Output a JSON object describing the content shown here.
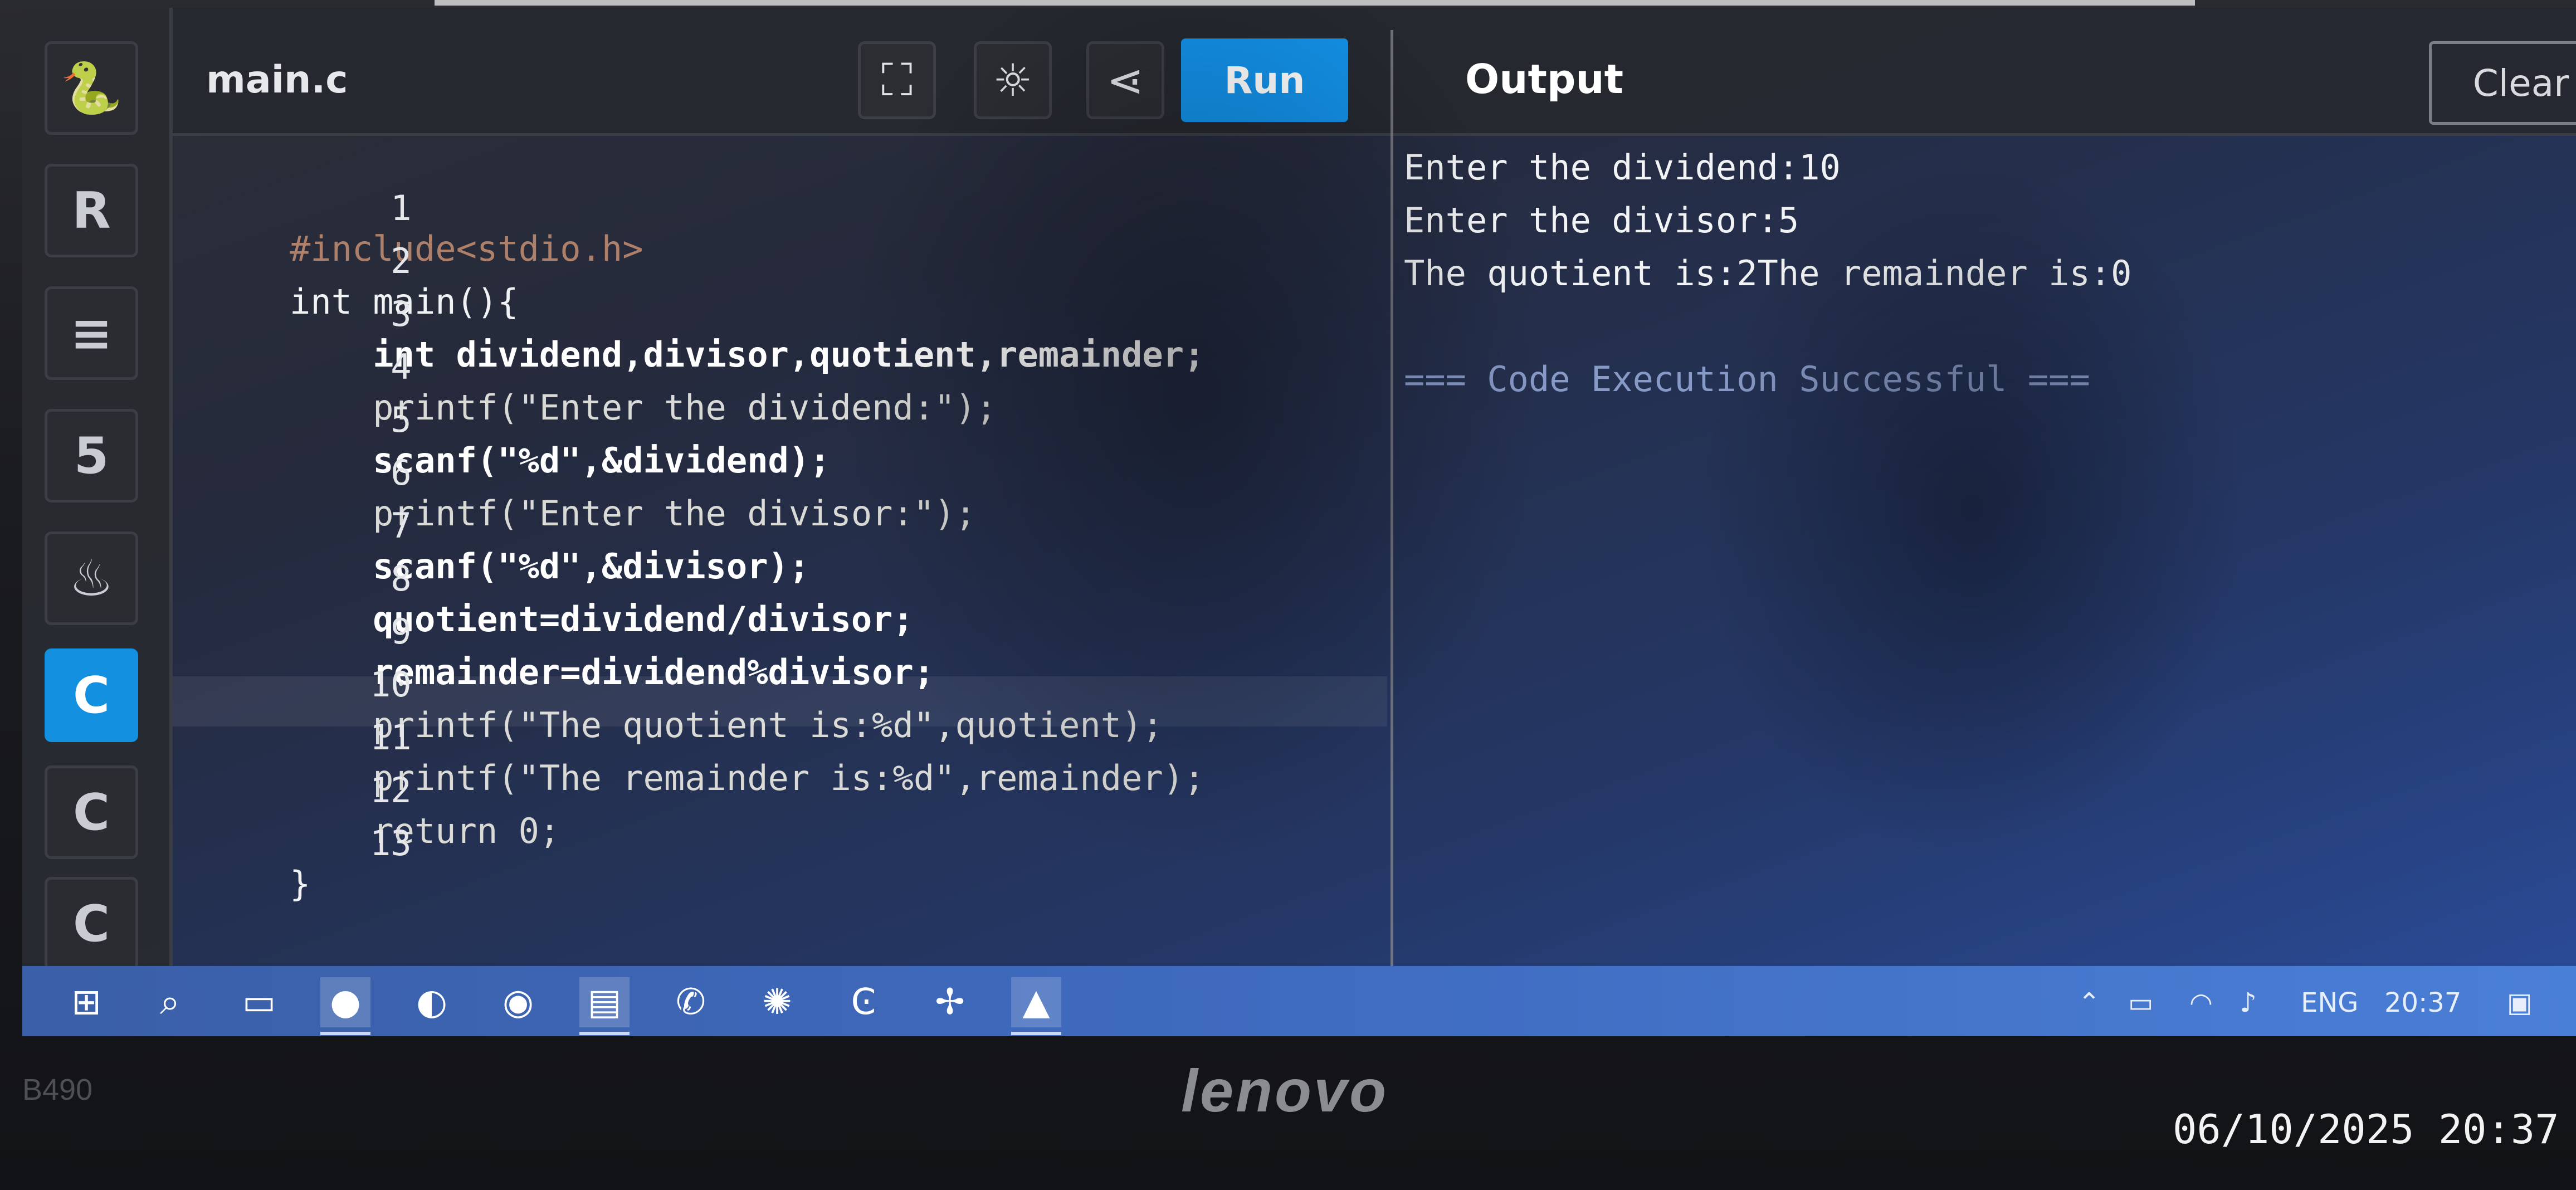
{
  "editor": {
    "file_name": "main.c",
    "lines": [
      {
        "num": "1",
        "text": "#include<stdio.h>"
      },
      {
        "num": "2",
        "text": "int main(){"
      },
      {
        "num": "3",
        "text": "    int dividend,divisor,quotient,remainder;"
      },
      {
        "num": "4",
        "text": "    printf(\"Enter the dividend:\");"
      },
      {
        "num": "5",
        "text": "    scanf(\"%d\",&dividend);"
      },
      {
        "num": "6",
        "text": "    printf(\"Enter the divisor:\");"
      },
      {
        "num": "7",
        "text": "    scanf(\"%d\",&divisor);"
      },
      {
        "num": "8",
        "text": "    quotient=dividend/divisor;"
      },
      {
        "num": "9",
        "text": "    remainder=dividend%divisor;"
      },
      {
        "num": "10",
        "text": "    printf(\"The quotient is:%d\",quotient);"
      },
      {
        "num": "11",
        "text": "    printf(\"The remainder is:%d\",remainder);"
      },
      {
        "num": "12",
        "text": "    return 0;"
      },
      {
        "num": "13",
        "text": "}"
      }
    ]
  },
  "toolbar": {
    "run_label": "Run",
    "output_title": "Output",
    "clear_label": "Clear",
    "language_tab_icons": [
      "python-icon",
      "r-icon",
      "database-icon",
      "html5-icon",
      "java-icon",
      "c-icon",
      "cpp-icon",
      "csharp-icon"
    ]
  },
  "output": {
    "lines": [
      "Enter the dividend:10",
      "Enter the divisor:5",
      "The quotient is:2The remainder is:0",
      "",
      "=== Code Execution Successful ==="
    ]
  },
  "taskbar": {
    "language": "ENG",
    "time": "20:37",
    "icons": [
      "windows-start-icon",
      "search-icon",
      "file-explorer-icon",
      "firefox-icon",
      "edge-icon",
      "teams-icon",
      "notepad-icon",
      "whatsapp-icon",
      "chatgpt-icon",
      "ccleaner-icon",
      "pinwheel-icon",
      "pdf-reader-icon"
    ]
  },
  "device": {
    "brand": "lenovo",
    "model": "B490"
  },
  "photo": {
    "timestamp": "06/10/2025 20:37"
  }
}
